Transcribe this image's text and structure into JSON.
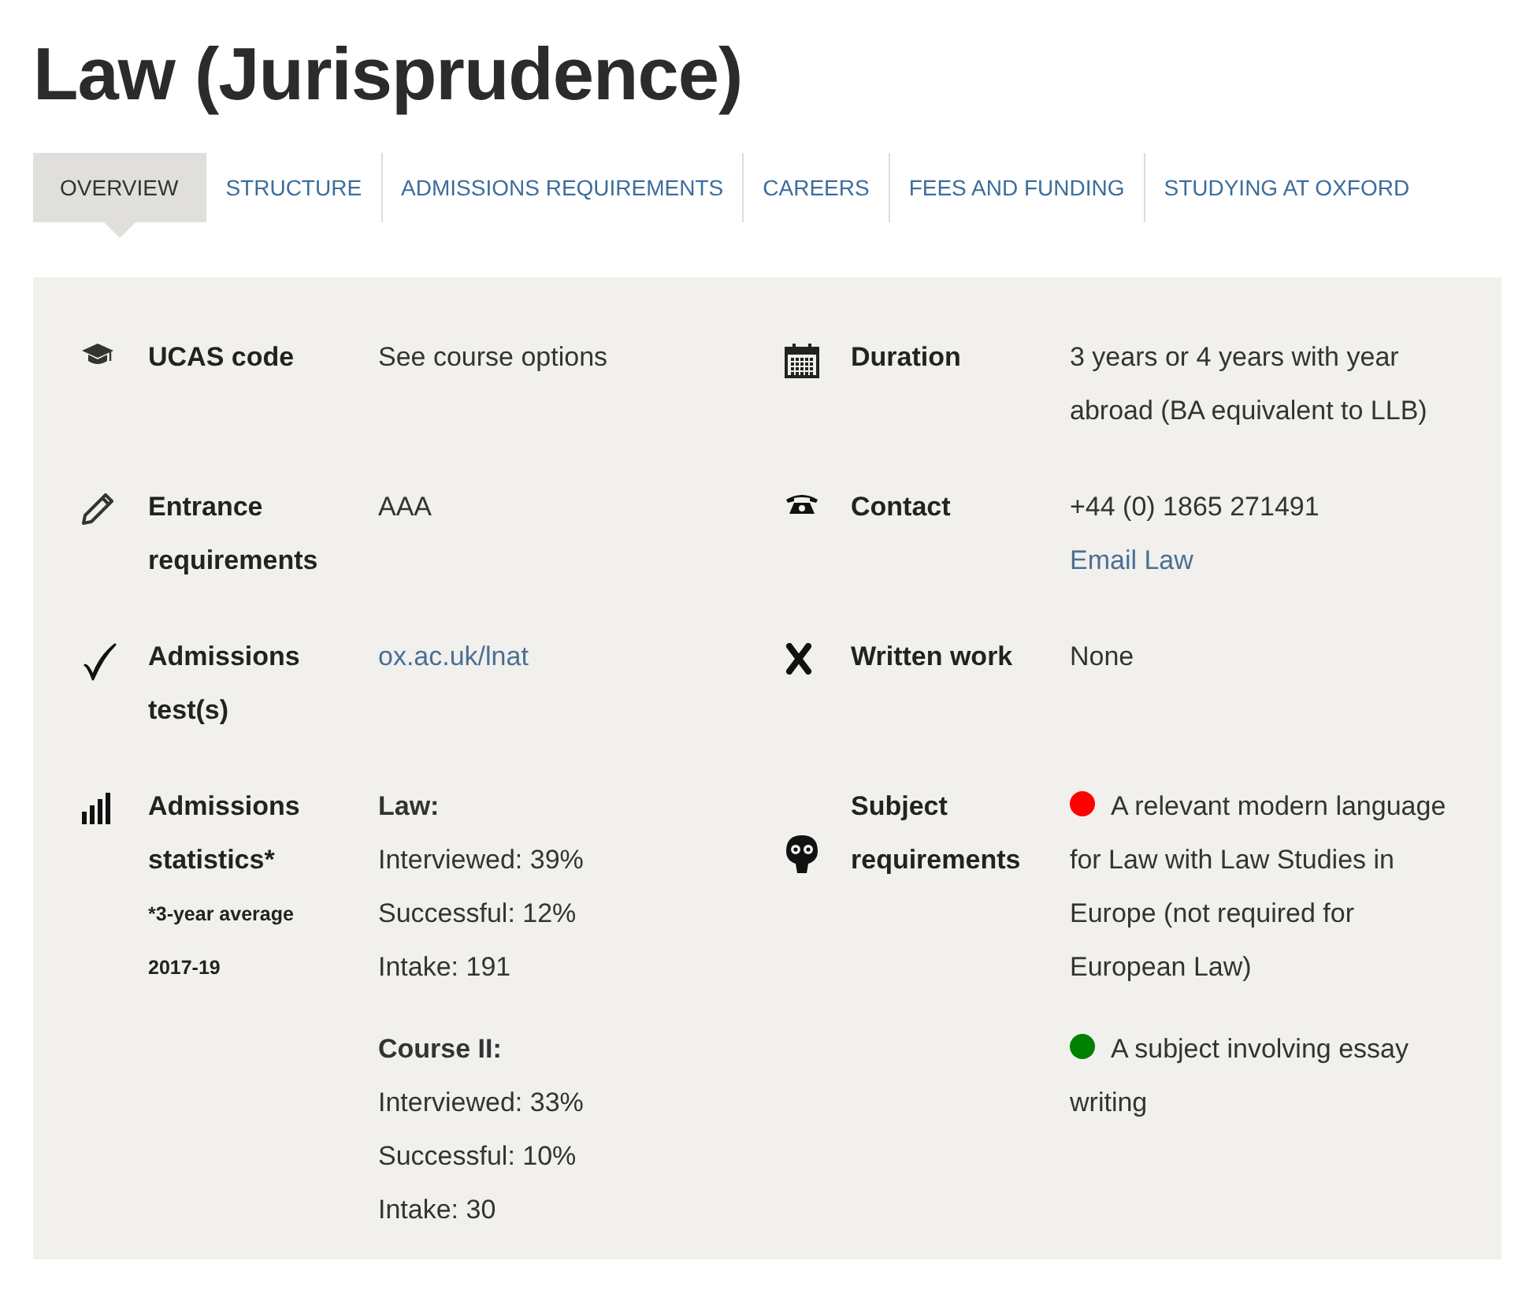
{
  "title": "Law (Jurisprudence)",
  "tabs": [
    {
      "label": "OVERVIEW",
      "selected": true
    },
    {
      "label": "STRUCTURE",
      "selected": false
    },
    {
      "label": "ADMISSIONS REQUIREMENTS",
      "selected": false
    },
    {
      "label": "CAREERS",
      "selected": false
    },
    {
      "label": "FEES AND FUNDING",
      "selected": false
    },
    {
      "label": "STUDYING AT OXFORD",
      "selected": false
    }
  ],
  "facts": [
    {
      "label": "UCAS code",
      "lines": [
        {
          "kind": "text",
          "text": "See course options"
        }
      ]
    },
    {
      "label": "Duration",
      "lines": [
        {
          "kind": "text",
          "text": "3 years or 4 years with year abroad (BA equivalent to LLB)"
        }
      ]
    },
    {
      "label": "Entrance requirements",
      "lines": [
        {
          "kind": "text",
          "text": "AAA"
        }
      ]
    },
    {
      "label": "Contact",
      "lines": [
        {
          "kind": "text",
          "text": "+44 (0) 1865 271491"
        },
        {
          "kind": "link",
          "text": "Email Law"
        }
      ]
    },
    {
      "label": "Admissions test(s)",
      "lines": [
        {
          "kind": "link",
          "text": "ox.ac.uk/lnat"
        }
      ]
    },
    {
      "label": "Written work",
      "lines": [
        {
          "kind": "text",
          "text": "None"
        }
      ]
    },
    {
      "label": "Admissions statistics*",
      "notes": [
        "*3-year average",
        "2017-19"
      ],
      "lines": [
        {
          "kind": "heading",
          "text": "Law:"
        },
        {
          "kind": "text",
          "text": "Interviewed: 39%"
        },
        {
          "kind": "text",
          "text": "Successful: 12%"
        },
        {
          "kind": "text",
          "text": "Intake: 191"
        },
        {
          "kind": "heading",
          "text": "Course II:"
        },
        {
          "kind": "text",
          "text": "Interviewed: 33%"
        },
        {
          "kind": "text",
          "text": "Successful: 10%"
        },
        {
          "kind": "text",
          "text": "Intake: 30"
        }
      ]
    },
    {
      "label": "Subject requirements",
      "lines": [
        {
          "kind": "requirement",
          "color": "#ff0000",
          "text": "A relevant modern language for Law with Law Studies in Europe (not required for European Law)"
        },
        {
          "kind": "requirement",
          "color": "#008000",
          "text": "A subject involving essay writing"
        }
      ]
    }
  ]
}
